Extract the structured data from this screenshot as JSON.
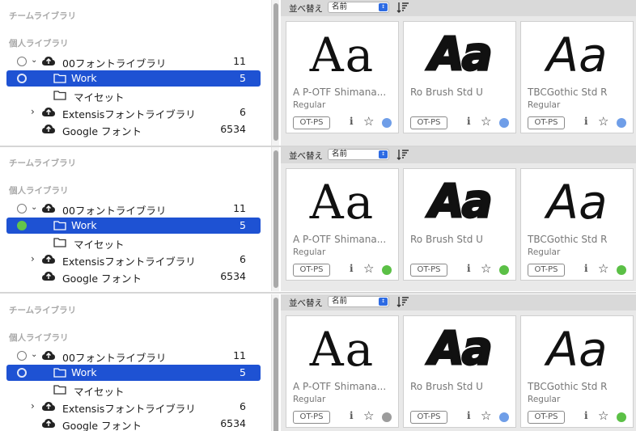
{
  "colors": {
    "selection": "#1e52d3",
    "active_blue": "#6f9ee8",
    "active_green": "#5bc046",
    "inactive_gray": "#9c9c9c"
  },
  "panels": [
    {
      "sidebar": {
        "team_label": "チームライブラリ",
        "personal_label": "個人ライブラリ",
        "items": [
          {
            "label": "00フォントライブラリ",
            "count": "11",
            "icon": "cloud-folder-icon"
          },
          {
            "label": "Work",
            "count": "5",
            "icon": "folder-icon",
            "state": "white-ring",
            "selected": true
          },
          {
            "label": "マイセット",
            "count": "",
            "icon": "folder-icon"
          },
          {
            "label": "Extensisフォントライブラリ",
            "count": "6",
            "icon": "cloud-folder-icon"
          },
          {
            "label": "Google フォント",
            "count": "6534",
            "icon": "cloud-folder-icon"
          }
        ]
      },
      "toolbar": {
        "sort_label": "並べ替え",
        "sort_value": "名前"
      },
      "cards": [
        {
          "sample": "Aa",
          "name": "A P-OTF Shimana...",
          "style": "Regular",
          "badge": "OT-PS",
          "status": "blue"
        },
        {
          "sample": "Aa",
          "name": "Ro Brush Std U",
          "style": "",
          "badge": "OT-PS",
          "status": "blue"
        },
        {
          "sample": "Aa",
          "name": "TBCGothic Std R",
          "style": "Regular",
          "badge": "OT-PS",
          "status": "blue"
        }
      ]
    },
    {
      "sidebar": {
        "team_label": "チームライブラリ",
        "personal_label": "個人ライブラリ",
        "items": [
          {
            "label": "00フォントライブラリ",
            "count": "11",
            "icon": "cloud-folder-icon"
          },
          {
            "label": "Work",
            "count": "5",
            "icon": "folder-icon",
            "state": "green",
            "selected": true
          },
          {
            "label": "マイセット",
            "count": "",
            "icon": "folder-icon"
          },
          {
            "label": "Extensisフォントライブラリ",
            "count": "6",
            "icon": "cloud-folder-icon"
          },
          {
            "label": "Google フォント",
            "count": "6534",
            "icon": "cloud-folder-icon"
          }
        ]
      },
      "toolbar": {
        "sort_label": "並べ替え",
        "sort_value": "名前"
      },
      "cards": [
        {
          "sample": "Aa",
          "name": "A P-OTF Shimana...",
          "style": "Regular",
          "badge": "OT-PS",
          "status": "green"
        },
        {
          "sample": "Aa",
          "name": "Ro Brush Std U",
          "style": "",
          "badge": "OT-PS",
          "status": "green"
        },
        {
          "sample": "Aa",
          "name": "TBCGothic Std R",
          "style": "Regular",
          "badge": "OT-PS",
          "status": "green"
        }
      ]
    },
    {
      "sidebar": {
        "team_label": "チームライブラリ",
        "personal_label": "個人ライブラリ",
        "items": [
          {
            "label": "00フォントライブラリ",
            "count": "11",
            "icon": "cloud-folder-icon"
          },
          {
            "label": "Work",
            "count": "5",
            "icon": "folder-icon",
            "state": "white-ring",
            "selected": true
          },
          {
            "label": "マイセット",
            "count": "",
            "icon": "folder-icon"
          },
          {
            "label": "Extensisフォントライブラリ",
            "count": "6",
            "icon": "cloud-folder-icon"
          },
          {
            "label": "Google フォント",
            "count": "6534",
            "icon": "cloud-folder-icon"
          }
        ]
      },
      "toolbar": {
        "sort_label": "並べ替え",
        "sort_value": "名前"
      },
      "cards": [
        {
          "sample": "Aa",
          "name": "A P-OTF Shimana...",
          "style": "Regular",
          "badge": "OT-PS",
          "status": "gray"
        },
        {
          "sample": "Aa",
          "name": "Ro Brush Std U",
          "style": "",
          "badge": "OT-PS",
          "status": "blue"
        },
        {
          "sample": "Aa",
          "name": "TBCGothic Std R",
          "style": "Regular",
          "badge": "OT-PS",
          "status": "green"
        }
      ]
    }
  ]
}
